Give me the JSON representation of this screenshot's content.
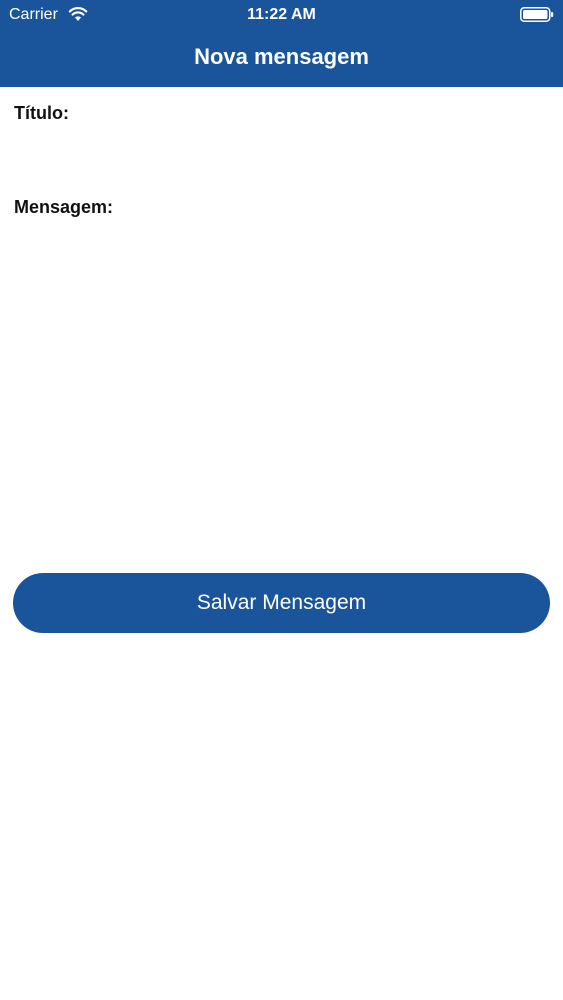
{
  "status_bar": {
    "carrier": "Carrier",
    "time": "11:22 AM"
  },
  "nav": {
    "title": "Nova mensagem"
  },
  "form": {
    "title_label": "Título:",
    "title_value": "",
    "message_label": "Mensagem:",
    "message_value": ""
  },
  "actions": {
    "save_label": "Salvar Mensagem"
  },
  "colors": {
    "primary": "#1a559b",
    "background": "#ffffff",
    "text": "#111111"
  }
}
